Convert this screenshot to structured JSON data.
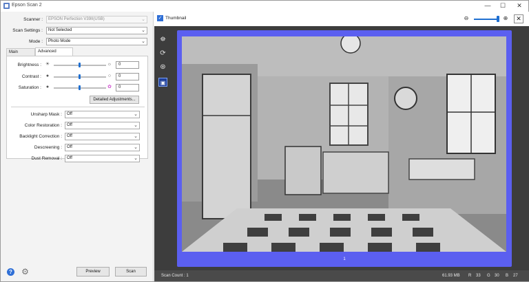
{
  "window": {
    "title": "Epson Scan 2",
    "minimize": "—",
    "maximize": "☐",
    "close": "✕"
  },
  "left": {
    "scanner": {
      "label": "Scanner :",
      "value": "EPSON Perfection V39II(USB)"
    },
    "scan_settings": {
      "label": "Scan Settings :",
      "value": "Not Selected"
    },
    "mode": {
      "label": "Mode :",
      "value": "Photo Mode"
    },
    "tabs": [
      {
        "label": "Main Settings"
      },
      {
        "label": "Advanced Settings"
      }
    ],
    "adjustments": [
      {
        "label": "Brightness :",
        "value": "0",
        "level": 0.5
      },
      {
        "label": "Contrast :",
        "value": "0",
        "level": 0.5
      },
      {
        "label": "Saturation :",
        "value": "0",
        "level": 0.5
      }
    ],
    "detailed_button": "Detailed Adjustments...",
    "options": [
      {
        "label": "Unsharp Mask :",
        "value": "Off"
      },
      {
        "label": "Color Restoration :",
        "value": "Off"
      },
      {
        "label": "Backlight Correction :",
        "value": "Off"
      },
      {
        "label": "Descreening :",
        "value": "Off"
      },
      {
        "label": "Dust Removal :",
        "value": "Off"
      }
    ],
    "preview_button": "Preview",
    "scan_button": "Scan"
  },
  "right": {
    "thumbnail_label": "Thumbnail",
    "zoom_level": 0.9,
    "page_number": "1",
    "status": {
      "scan_count": "Scan Count : 1",
      "file_size": "61.93 MB",
      "r": "R",
      "r_val": "33",
      "g": "G",
      "g_val": "30",
      "b": "B",
      "b_val": "27"
    }
  },
  "colors": {
    "accent": "#1f6fd1",
    "preview_frame": "#5b5ff0",
    "panel_dark": "#3d3d3d"
  }
}
